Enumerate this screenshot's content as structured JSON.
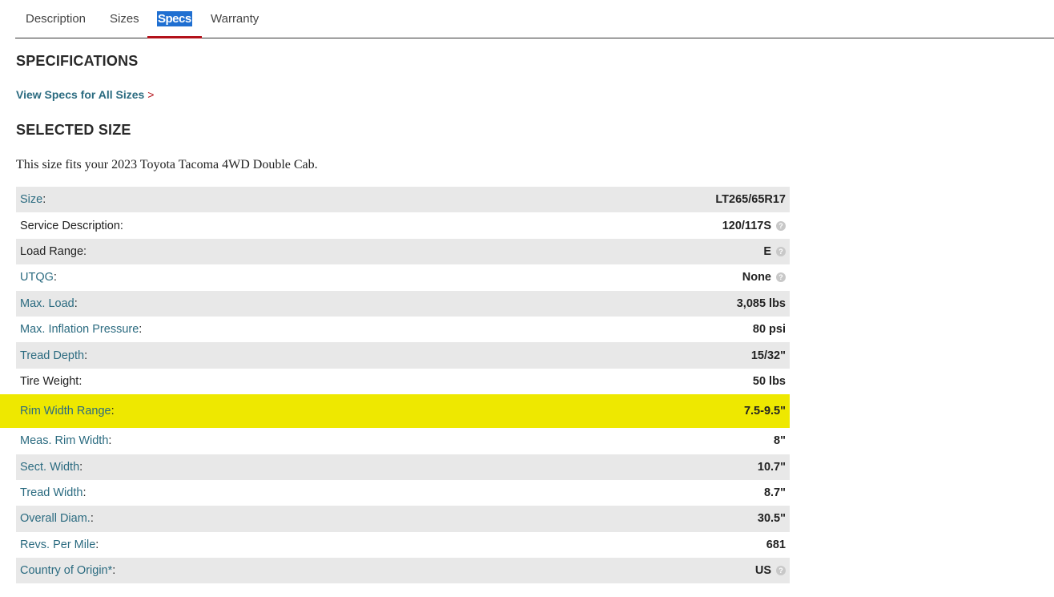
{
  "tabs": [
    {
      "label": "Description",
      "active": false
    },
    {
      "label": "Sizes",
      "active": false
    },
    {
      "label": "Specs",
      "active": true
    },
    {
      "label": "Warranty",
      "active": false
    }
  ],
  "specifications_heading": "SPECIFICATIONS",
  "view_all_link": "View Specs for All Sizes",
  "view_all_chevron": ">",
  "selected_size_heading": "SELECTED SIZE",
  "fit_text": "This size fits your 2023 Toyota Tacoma 4WD Double Cab.",
  "colors": {
    "highlight": "#eee800",
    "link": "#2b6b80",
    "accent": "#b3121a",
    "tab_active_bg": "#1f6fd1"
  },
  "specs": [
    {
      "label": "Size",
      "value": "LT265/65R17",
      "link": true,
      "help": false
    },
    {
      "label": "Service Description",
      "value": "120/117S",
      "link": false,
      "help": true
    },
    {
      "label": "Load Range",
      "value": "E",
      "link": false,
      "help": true
    },
    {
      "label": "UTQG",
      "value": "None",
      "link": true,
      "help": true
    },
    {
      "label": "Max. Load",
      "value": "3,085 lbs",
      "link": true,
      "help": false
    },
    {
      "label": "Max. Inflation Pressure",
      "value": "80 psi",
      "link": true,
      "help": false
    },
    {
      "label": "Tread Depth",
      "value": "15/32\"",
      "link": true,
      "help": false
    },
    {
      "label": "Tire Weight",
      "value": "50 lbs",
      "link": false,
      "help": false
    },
    {
      "label": "Rim Width Range",
      "value": "7.5-9.5\"",
      "link": true,
      "help": false,
      "highlighted": true
    },
    {
      "label": "Meas. Rim Width",
      "value": "8\"",
      "link": true,
      "help": false
    },
    {
      "label": "Sect. Width",
      "value": "10.7\"",
      "link": true,
      "help": false
    },
    {
      "label": "Tread Width",
      "value": "8.7\"",
      "link": true,
      "help": false
    },
    {
      "label": "Overall Diam.",
      "value": "30.5\"",
      "link": true,
      "help": false
    },
    {
      "label": "Revs. Per Mile",
      "value": "681",
      "link": true,
      "help": false
    },
    {
      "label": "Country of Origin*",
      "value": "US",
      "link": true,
      "help": true
    }
  ],
  "help_glyph": "?",
  "colon": ":"
}
